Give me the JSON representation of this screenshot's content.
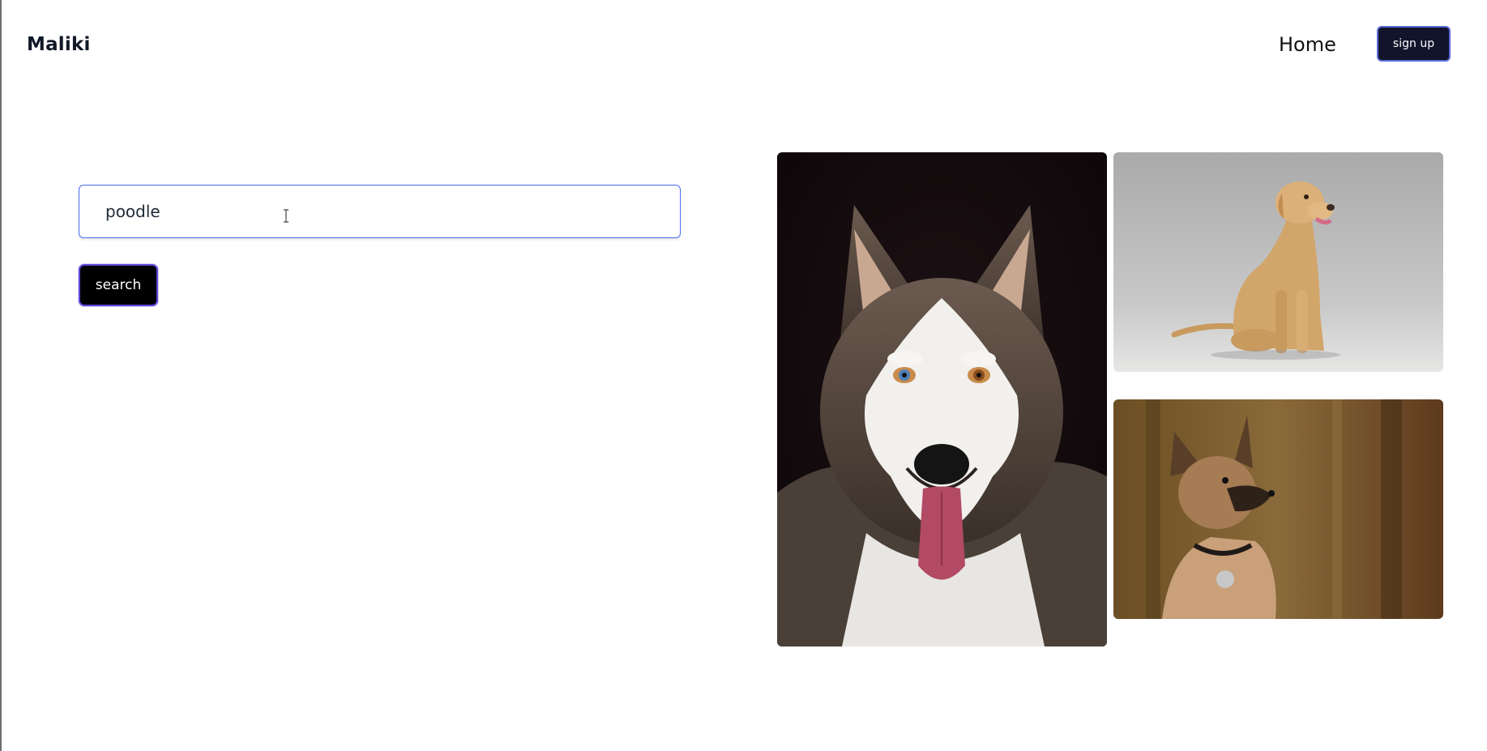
{
  "header": {
    "brand": "Maliki",
    "nav_home": "Home",
    "signup_label": "sign up"
  },
  "search": {
    "value": "poodle",
    "button_label": "search"
  },
  "gallery": {
    "images": [
      {
        "subject": "husky"
      },
      {
        "subject": "labrador"
      },
      {
        "subject": "malinois-puppy"
      }
    ]
  },
  "colors": {
    "accent_border": "#5b6bd8",
    "button_dark": "#11142b",
    "input_border": "#4c6ff0"
  }
}
